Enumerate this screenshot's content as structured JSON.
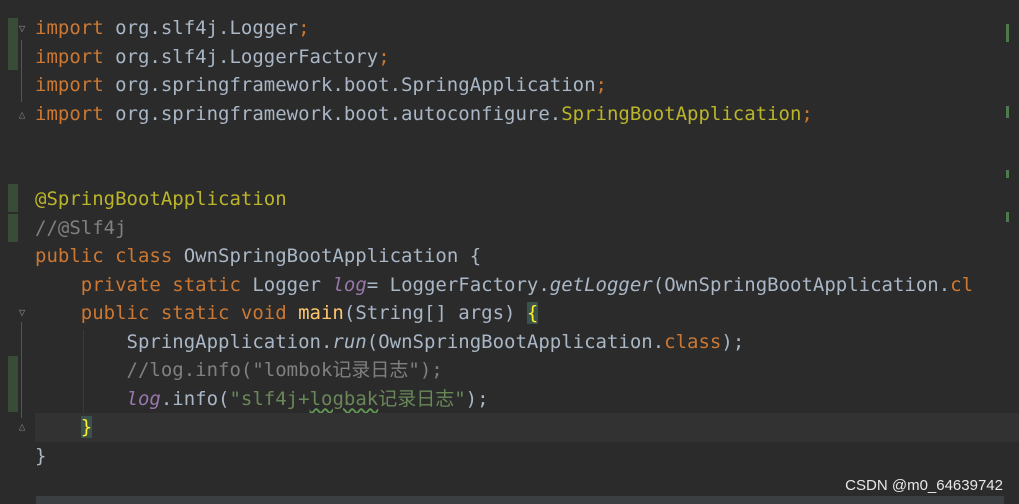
{
  "editor": {
    "lines": [
      [
        {
          "t": "import",
          "c": "kw"
        },
        {
          "t": " org.slf4j.Logger",
          "c": "cls"
        },
        {
          "t": ";",
          "c": "kw"
        }
      ],
      [
        {
          "t": "import",
          "c": "kw"
        },
        {
          "t": " org.slf4j.LoggerFactory",
          "c": "cls"
        },
        {
          "t": ";",
          "c": "kw"
        }
      ],
      [
        {
          "t": "import",
          "c": "kw"
        },
        {
          "t": " org.springframework.boot.SpringApplication",
          "c": "cls"
        },
        {
          "t": ";",
          "c": "kw"
        }
      ],
      [
        {
          "t": "import",
          "c": "kw"
        },
        {
          "t": " org.springframework.boot.autoconfigure.",
          "c": "cls"
        },
        {
          "t": "SpringBootApplication",
          "c": "warn-cls"
        },
        {
          "t": ";",
          "c": "kw"
        }
      ],
      [],
      [],
      [
        {
          "t": "@SpringBootApplication",
          "c": "ann"
        }
      ],
      [
        {
          "t": "//@Slf4j",
          "c": "cm"
        }
      ],
      [
        {
          "t": "public class ",
          "c": "kw"
        },
        {
          "t": "OwnSpringBootApplication {",
          "c": "cls"
        }
      ],
      [
        {
          "t": "    "
        },
        {
          "t": "private static ",
          "c": "kw"
        },
        {
          "t": "Logger ",
          "c": "cls"
        },
        {
          "t": "log",
          "c": "fld"
        },
        {
          "t": "= LoggerFactory.",
          "c": "cls"
        },
        {
          "t": "getLogger",
          "c": "it"
        },
        {
          "t": "(OwnSpringBootApplication.",
          "c": "cls"
        },
        {
          "t": "cl",
          "c": "kw"
        }
      ],
      [
        {
          "t": "    "
        },
        {
          "t": "public static void ",
          "c": "kw"
        },
        {
          "t": "main",
          "c": "fn"
        },
        {
          "t": "(String[] args) ",
          "c": "cls"
        },
        {
          "t": "{",
          "c": "brace-hl"
        }
      ],
      [
        {
          "t": "        "
        },
        {
          "t": "SpringApplication.",
          "c": "cls"
        },
        {
          "t": "run",
          "c": "it"
        },
        {
          "t": "(OwnSpringBootApplication.",
          "c": "cls"
        },
        {
          "t": "class",
          "c": "kw"
        },
        {
          "t": ");",
          "c": "cls"
        }
      ],
      [
        {
          "t": "        "
        },
        {
          "t": "//log.info(\"lombok记录日志\");",
          "c": "cm"
        }
      ],
      [
        {
          "t": "        "
        },
        {
          "t": "log",
          "c": "fld"
        },
        {
          "t": ".info(",
          "c": "cls"
        },
        {
          "t": "\"slf4j+",
          "c": "str"
        },
        {
          "t": "logbak",
          "c": "str typo"
        },
        {
          "t": "记录日志\"",
          "c": "str"
        },
        {
          "t": ");",
          "c": "cls"
        }
      ],
      [
        {
          "t": "    "
        },
        {
          "t": "}",
          "c": "brace-hl"
        }
      ],
      [
        {
          "t": "}",
          "c": "cls"
        }
      ]
    ],
    "current_line_index": 14
  },
  "watermark": "CSDN @m0_64639742"
}
